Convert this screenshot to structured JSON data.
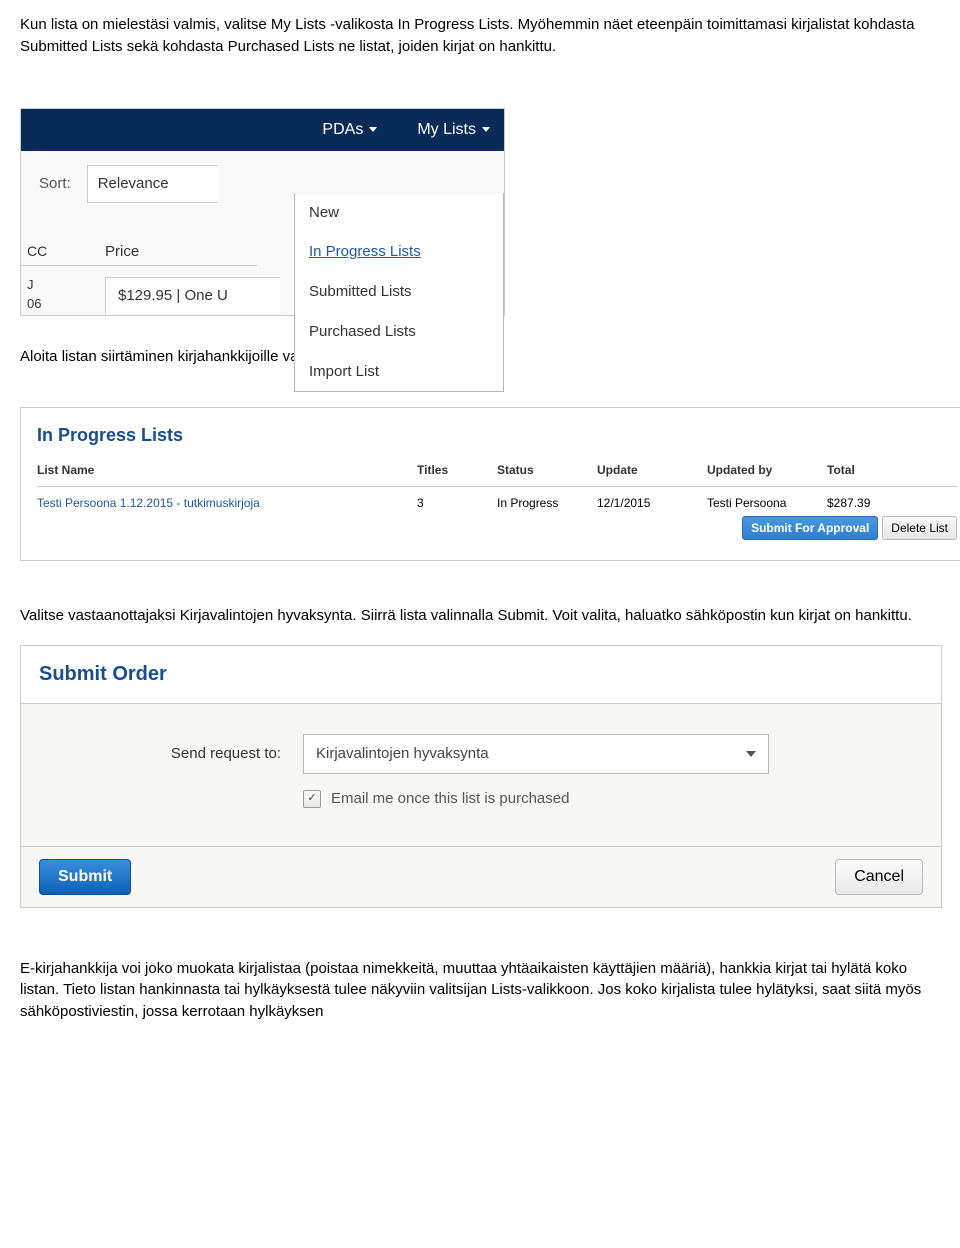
{
  "para1": "Kun lista on mielestäsi valmis, valitse My Lists -valikosta In Progress Lists. Myöhemmin näet eteenpäin toimittamasi kirjalistat kohdasta Submitted Lists sekä kohdasta Purchased Lists ne listat, joiden kirjat on hankittu.",
  "para2": "Aloita listan siirtäminen kirjahankkijoille valinnalla Submit For Approval.",
  "para3": "Valitse vastaanottajaksi Kirjavalintojen hyvaksynta. Siirrä lista valinnalla Submit. Voit valita, haluatko sähköpostin kun kirjat on hankittu.",
  "para4": "E-kirjahankkija voi joko muokata kirjalistaa (poistaa nimekkeitä, muuttaa yhtäaikaisten käyttäjien määriä), hankkia kirjat tai hylätä koko listan. Tieto listan hankinnasta tai hylkäyksestä tulee näkyviin valitsijan Lists-valikkoon. Jos koko kirjalista tulee hylätyksi, saat siitä myös sähköpostiviestin, jossa kerrotaan hylkäyksen",
  "ss1": {
    "nav": {
      "pdas": "PDAs",
      "mylists": "My Lists"
    },
    "sort_label": "Sort:",
    "sort_value": "Relevance",
    "cc": "CC",
    "price_header": "Price",
    "lu": "J\n06",
    "price_value": "$129.95 | One U",
    "menu": {
      "new": "New",
      "inprogress": "In Progress Lists",
      "submitted": "Submitted Lists",
      "purchased": "Purchased Lists",
      "import": "Import List"
    }
  },
  "ss2": {
    "title": "In Progress Lists",
    "headers": {
      "name": "List Name",
      "titles": "Titles",
      "status": "Status",
      "update": "Update",
      "updatedby": "Updated by",
      "total": "Total"
    },
    "row": {
      "name": "Testi Persoona 1.12.2015 - tutkimuskirjoja",
      "titles": "3",
      "status": "In Progress",
      "update": "12/1/2015",
      "updatedby": "Testi Persoona",
      "total": "$287.39"
    },
    "submit": "Submit For Approval",
    "delete": "Delete List"
  },
  "ss3": {
    "title": "Submit Order",
    "send_label": "Send request to:",
    "select_value": "Kirjavalintojen hyvaksynta",
    "check_label": "Email me once this list is purchased",
    "submit": "Submit",
    "cancel": "Cancel"
  }
}
